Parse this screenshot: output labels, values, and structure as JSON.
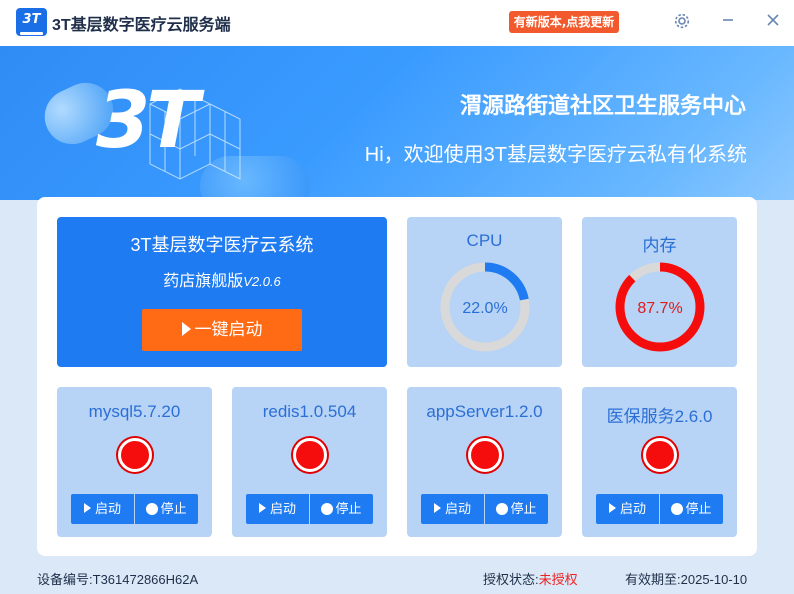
{
  "window": {
    "title": "3T基层数字医疗云服务端",
    "logo_text": "3T",
    "update_notice": "有新版本,点我更新",
    "icons": [
      "gear-icon",
      "minimize-icon",
      "close-icon"
    ]
  },
  "hero": {
    "logo_text": "3T",
    "center_name": "渭源路街道社区卫生服务中心",
    "welcome": "Hi，欢迎使用3T基层数字医疗云私有化系统"
  },
  "launch": {
    "system_name": "3T基层数字医疗云系统",
    "edition": "药店旗舰版",
    "version": "V2.0.6",
    "button_label": "一键启动"
  },
  "gauges": [
    {
      "label": "CPU",
      "value_text": "22.0%",
      "value": 22.0,
      "color": "#1f7bf2",
      "text_color": "#2b6fd6"
    },
    {
      "label": "内存",
      "value_text": "87.7%",
      "value": 87.7,
      "color": "#f50d0d",
      "text_color": "#e01b1b"
    }
  ],
  "services": [
    {
      "name": "mysql5.7.20",
      "status": "stopped",
      "start_label": "启动",
      "stop_label": "停止"
    },
    {
      "name": "redis1.0.504",
      "status": "stopped",
      "start_label": "启动",
      "stop_label": "停止"
    },
    {
      "name": "appServer1.2.0",
      "status": "stopped",
      "start_label": "启动",
      "stop_label": "停止"
    },
    {
      "name": "医保服务2.6.0",
      "status": "stopped",
      "start_label": "启动",
      "stop_label": "停止"
    }
  ],
  "footer": {
    "device_label": "设备编号:",
    "device_id": "T361472866H62A",
    "license_label": "授权状态:",
    "license_status": "未授权",
    "expiry_label": "有效期至:",
    "expiry_date": "2025-10-10"
  },
  "colors": {
    "accent": "#1f7bf2",
    "launch_button": "#ff6a14",
    "update_badge": "#f2592c",
    "status_stopped": "#f50d0d"
  }
}
